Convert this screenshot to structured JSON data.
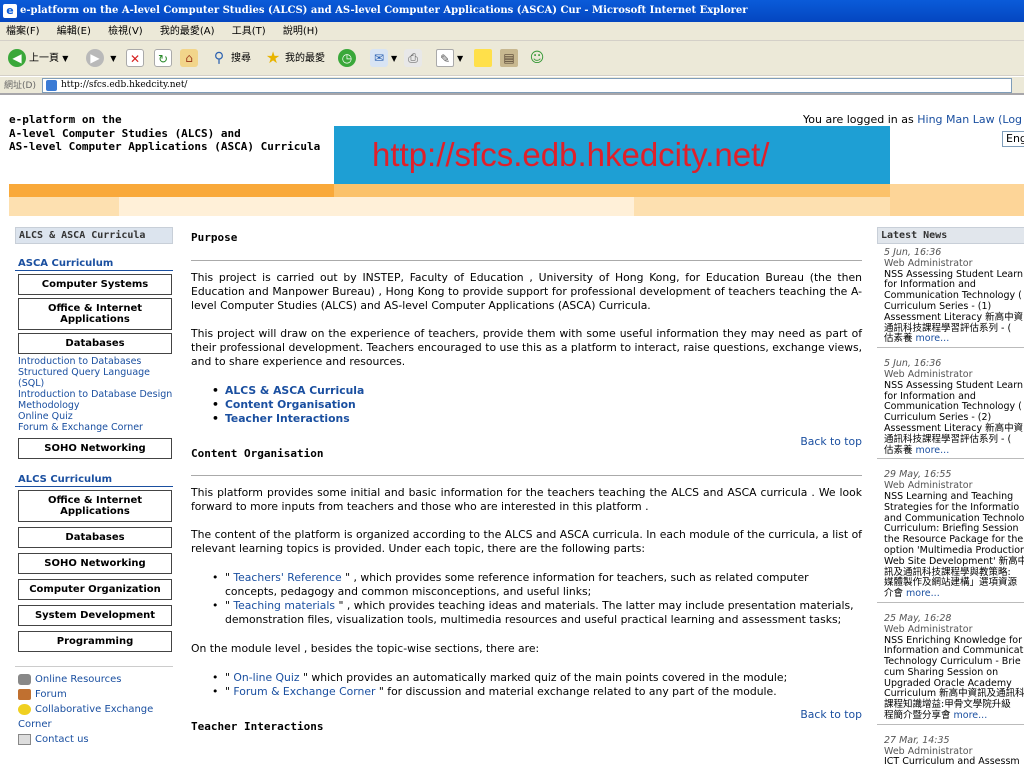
{
  "window": {
    "title": "e-platform on the A-level Computer Studies (ALCS) and AS-level Computer Applications (ASCA) Cur - Microsoft Internet Explorer"
  },
  "menu": [
    "檔案(F)",
    "編輯(E)",
    "檢視(V)",
    "我的最愛(A)",
    "工具(T)",
    "說明(H)"
  ],
  "toolbar": {
    "back_label": "上一頁",
    "search_label": "搜尋",
    "favorites_label": "我的最愛"
  },
  "address": {
    "label": "網址(D)",
    "url": "http://sfcs.edb.hkedcity.net/"
  },
  "header": {
    "title_lines": [
      "e-platform on the",
      "A-level Computer Studies (ALCS) and",
      "AS-level Computer Applications (ASCA) Curricula"
    ],
    "login_prefix": "You are logged in as",
    "login_user": "Hing Man Law (Log",
    "language": "Eng",
    "banner_url": "http://sfcs.edb.hkedcity.net/"
  },
  "sidebar": {
    "heading": "ALCS & ASCA Curricula",
    "asca_title": "ASCA Curriculum",
    "asca_items": [
      "Computer Systems",
      "Office & Internet Applications",
      "Databases"
    ],
    "db_links": [
      "Introduction to Databases",
      "Structured Query Language (SQL)",
      "Introduction to Database Design Methodology",
      "Online Quiz",
      "Forum & Exchange Corner"
    ],
    "asca_soho": "SOHO Networking",
    "alcs_title": "ALCS Curriculum",
    "alcs_items": [
      "Office & Internet Applications",
      "Databases",
      "SOHO Networking",
      "Computer Organization",
      "System Development",
      "Programming"
    ],
    "footer_links": [
      "Online Resources",
      "Forum",
      "Collaborative Exchange Corner",
      "Contact us"
    ]
  },
  "main": {
    "purpose_heading": "Purpose",
    "purpose_p1": "This project is carried out by INSTEP, Faculty of Education , University of Hong Kong, for Education Bureau (the then Education and Manpower Bureau) , Hong Kong to provide support for professional development of teachers teaching the A-level Computer Studies (ALCS) and AS-level Computer Applications (ASCA) Curricula.",
    "purpose_p2": "This project will draw on the experience of teachers, provide them with some useful information they may need as part of their professional development. Teachers encouraged to use this as a platform to interact, raise questions, exchange views, and to share experience and resources.",
    "toc": [
      "ALCS & ASCA Curricula",
      "Content Organisation",
      "Teacher Interactions"
    ],
    "back_to_top": "Back to top",
    "content_heading": "Content Organisation",
    "content_p1": "This platform provides some initial and basic information for the teachers teaching the ALCS and ASCA curricula . We look forward to more inputs from teachers and those who are interested in this platform .",
    "content_p2": "The content of the platform is organized according to the ALCS and ASCA curricula. In each module of the curricula, a list of relevant learning topics is provided. Under each topic, there are the following parts:",
    "parts": [
      {
        "pre": "\" ",
        "link": "Teachers' Reference",
        "post": " \" , which provides some reference information for teachers, such as related computer concepts, pedagogy and common misconceptions, and useful links;"
      },
      {
        "pre": "\" ",
        "link": "Teaching materials",
        "post": " \" , which provides teaching ideas and materials. The latter may include presentation materials, demonstration files, visualization tools, multimedia resources and useful practical learning and assessment tasks;"
      }
    ],
    "module_p": "On the module level , besides the topic-wise sections, there are:",
    "module_parts": [
      {
        "pre": "\" ",
        "link": "On-line Quiz",
        "post": " \" which provides an automatically marked quiz of the main points covered in the module;"
      },
      {
        "pre": "\" ",
        "link": "Forum & Exchange Corner",
        "post": " \" for discussion and material exchange related to any part of the module."
      }
    ],
    "next_heading": "Teacher Interactions"
  },
  "news": {
    "heading": "Latest News",
    "more": "more...",
    "items": [
      {
        "date": "5 Jun, 16:36",
        "author": "Web Administrator",
        "lines": [
          "NSS Assessing Student Learn",
          "for Information and",
          "Communication Technology (",
          "Curriculum Series - (1)",
          "Assessment Literacy 新高中資",
          "通訊科技課程學習評估系列 - (",
          "估素養"
        ]
      },
      {
        "date": "5 Jun, 16:36",
        "author": "Web Administrator",
        "lines": [
          "NSS Assessing Student Learn",
          "for Information and",
          "Communication Technology (",
          "Curriculum Series - (2)",
          "Assessment Literacy 新高中資",
          "通訊科技課程學習評估系列 - (",
          "估素養"
        ]
      },
      {
        "date": "29 May, 16:55",
        "author": "Web Administrator",
        "lines": [
          "NSS Learning and Teaching",
          "Strategies for the Informatio",
          "and Communication Technolo",
          "Curriculum: Briefing Session",
          "the Resource Package for the",
          "option 'Multimedia Production",
          "Web Site Development' 新高中",
          "訊及通訊科技課程學與教策略:",
          "媒體製作及網站建構」選項資源",
          "介會"
        ]
      },
      {
        "date": "25 May, 16:28",
        "author": "Web Administrator",
        "lines": [
          "NSS Enriching Knowledge for",
          "Information and Communicati",
          "Technology Curriculum - Brie",
          "cum Sharing Session on",
          "Upgraded Oracle Academy",
          "Curriculum 新高中資訊及通訊科",
          "課程知識增益:甲骨文學院升級",
          "程簡介暨分享會"
        ]
      },
      {
        "date": "27 Mar, 14:35",
        "author": "Web Administrator",
        "lines": [
          "ICT Curriculum and Assessm"
        ]
      }
    ]
  },
  "colors": {
    "accent_blue": "#1a4fa0",
    "banner_bg": "#1e9fd4",
    "banner_text": "#e0202a",
    "stripe_orange": "#f9a93a"
  }
}
